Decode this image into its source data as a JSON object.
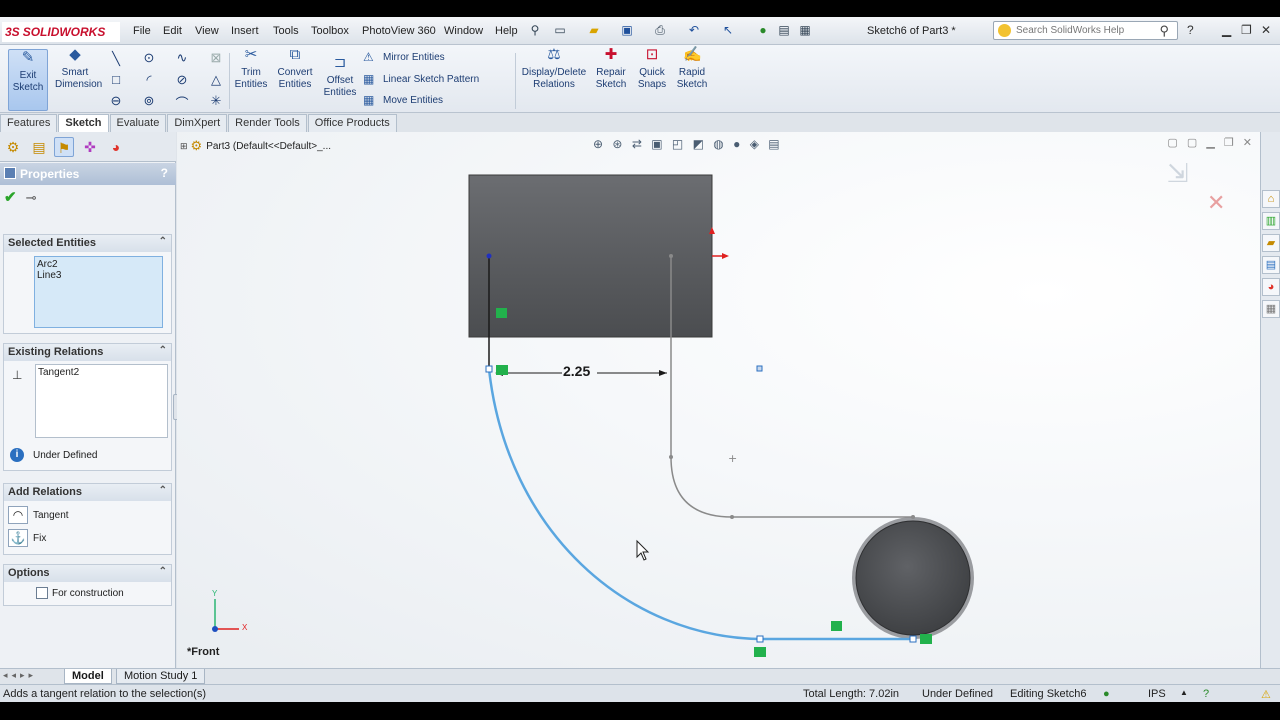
{
  "app": {
    "logo_ds": "3S",
    "logo_text": "SOLIDWORKS",
    "document_title": "Sketch6 of Part3 *",
    "menus": [
      "File",
      "Edit",
      "View",
      "Insert",
      "Tools",
      "Toolbox",
      "PhotoView 360",
      "Window",
      "Help"
    ],
    "search_placeholder": "Search SolidWorks Help"
  },
  "toolbar": {
    "exit_sketch": "Exit Sketch",
    "smart_dimension": "Smart Dimension",
    "trim_entities": "Trim Entities",
    "convert_entities": "Convert Entities",
    "offset_entities": "Offset Entities",
    "mirror_entities": "Mirror Entities",
    "linear_sketch_pattern": "Linear Sketch Pattern",
    "move_entities": "Move Entities",
    "display_delete_relations": "Display/Delete Relations",
    "repair_sketch": "Repair Sketch",
    "quick_snaps": "Quick Snaps",
    "rapid_sketch": "Rapid Sketch"
  },
  "tabs": [
    "Features",
    "Sketch",
    "Evaluate",
    "DimXpert",
    "Render Tools",
    "Office Products"
  ],
  "active_tab": "Sketch",
  "properties": {
    "title": "Properties",
    "help": "?",
    "selected_entities": {
      "header": "Selected Entities",
      "items": [
        "Arc2",
        "Line3"
      ]
    },
    "existing_relations": {
      "header": "Existing Relations",
      "items": [
        "Tangent2"
      ],
      "status": "Under Defined"
    },
    "add_relations": {
      "header": "Add Relations",
      "items": [
        "Tangent",
        "Fix"
      ]
    },
    "options": {
      "header": "Options",
      "for_construction": "For construction"
    }
  },
  "graphics": {
    "tree_label": "Part3  (Default<<Default>_...",
    "dimension_value": "2.25",
    "view_name": "*Front",
    "axis_x": "X",
    "axis_y": "Y"
  },
  "bottom_tabs": [
    "Model",
    "Motion Study 1"
  ],
  "status": {
    "hint": "Adds a tangent relation to the selection(s)",
    "total_length": "Total Length: 7.02in",
    "definition": "Under Defined",
    "editing": "Editing Sketch6",
    "units": "IPS"
  },
  "colors": {
    "selection_blue": "#5aa6e0",
    "sketch_grey": "#8a8a8a",
    "relation_green": "#22b14c",
    "solid_body": "#5b5d60"
  }
}
